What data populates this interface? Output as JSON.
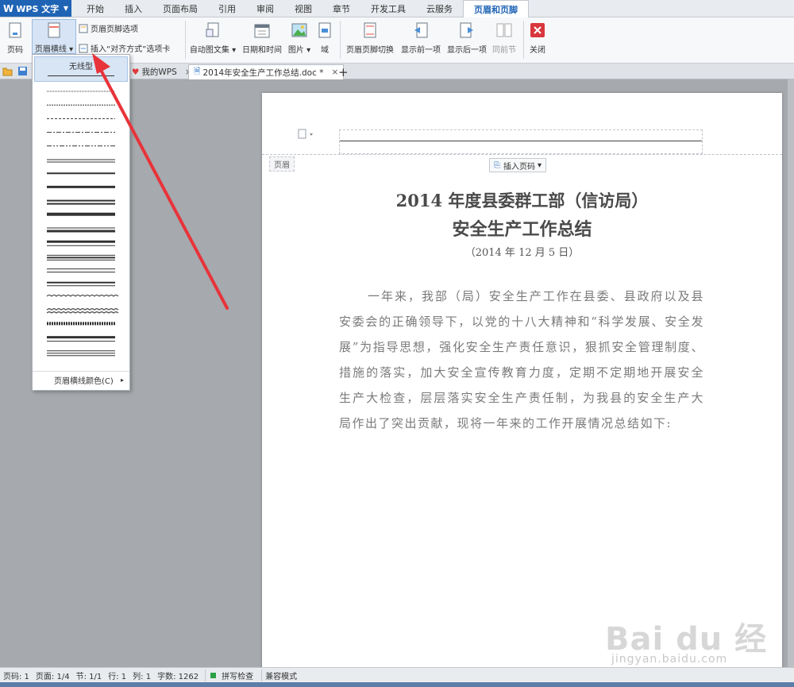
{
  "app": {
    "name": "WPS 文字"
  },
  "menu": {
    "tabs": [
      "开始",
      "插入",
      "页面布局",
      "引用",
      "审阅",
      "视图",
      "章节",
      "开发工具",
      "云服务",
      "页眉和页脚"
    ],
    "active": "页眉和页脚"
  },
  "ribbon": {
    "page_number": "页码",
    "header_line": "页眉横线",
    "header_footer_options": "页眉页脚选项",
    "insert_tab_stop": "插入“对齐方式”选项卡",
    "auto_text": "自动图文集",
    "date_time": "日期和时间",
    "picture": "图片",
    "field": "域",
    "switch_header_footer": "页眉页脚切换",
    "show_previous": "显示前一项",
    "show_next": "显示后一项",
    "same_as_previous": "同前节",
    "close": "关闭"
  },
  "tabs": {
    "my_wps": "我的WPS",
    "document": "2014年安全生产工作总结.doc *"
  },
  "dropdown": {
    "first_item": "无线型",
    "color_item": "页眉横线颜色(C)"
  },
  "document": {
    "header_label": "页眉",
    "insert_page_number": "插入页码",
    "title_line1": "2014 年度县委群工部（信访局）",
    "title_line2": "安全生产工作总结",
    "date": "（2014 年 12 月 5 日）",
    "body": "一年来，我部（局）安全生产工作在县委、县政府以及县安委会的正确领导下，以党的十八大精神和“科学发展、安全发展”为指导思想，强化安全生产责任意识，狠抓安全管理制度、措施的落实，加大安全宣传教育力度，定期不定期地开展安全生产大检查，层层落实安全生产责任制，为我县的安全生产大局作出了突出贡献，现将一年来的工作开展情况总结如下:"
  },
  "status": {
    "page_num": "页码: 1",
    "pages": "页面: 1/4",
    "section": "节: 1/1",
    "row": "行: 1",
    "col": "列: 1",
    "word_count": "字数: 1262",
    "spell_check": "拼写检查",
    "compat_mode": "兼容模式"
  },
  "watermark": {
    "brand": "Bai du 经验",
    "url": "jingyan.baidu.com"
  },
  "colors": {
    "accent": "#1f64b4",
    "annotation_arrow": "#e8333a"
  }
}
